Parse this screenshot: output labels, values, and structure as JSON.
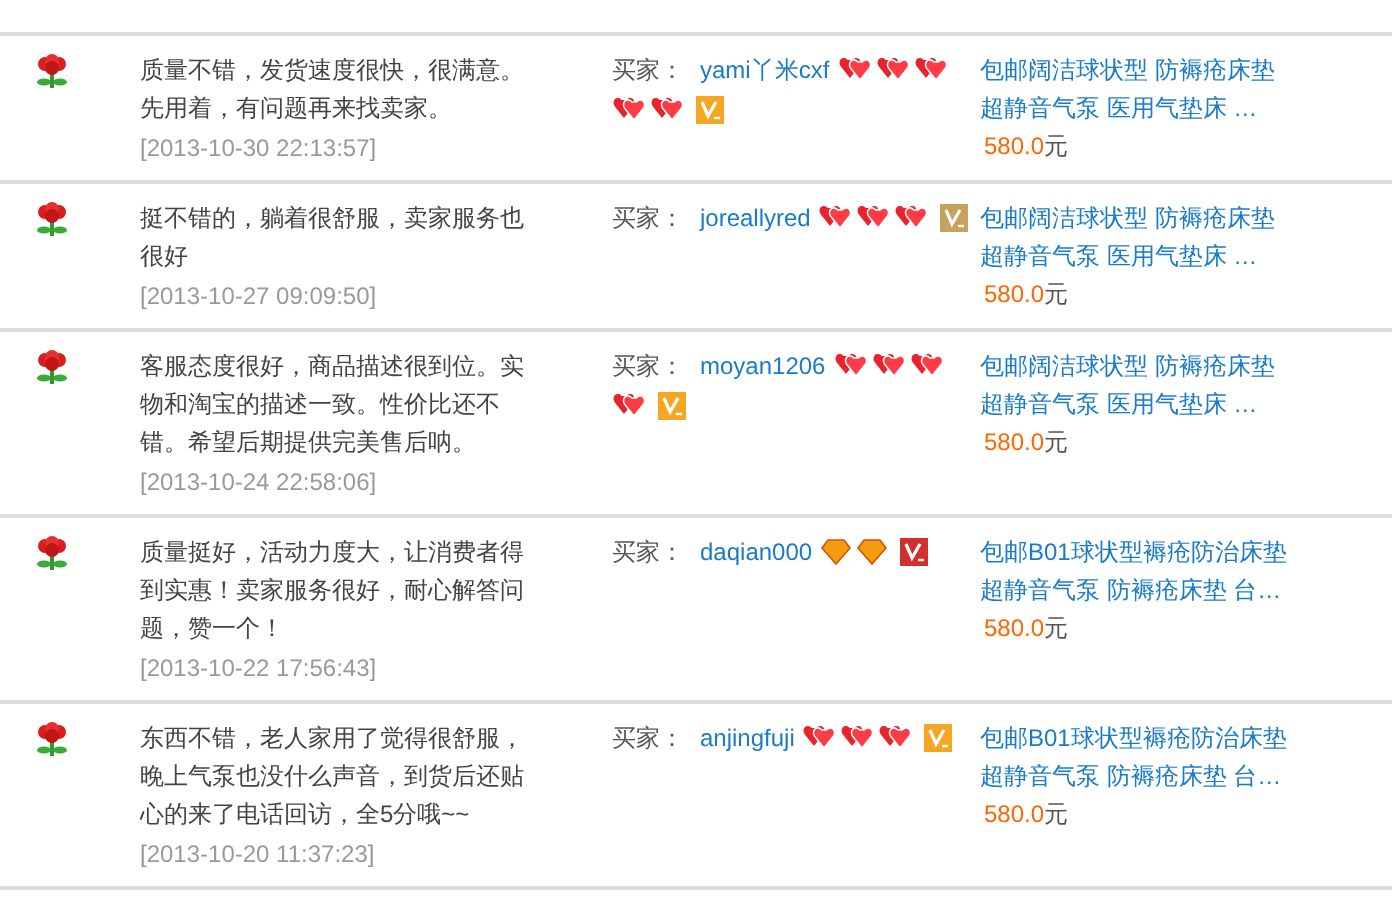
{
  "reviews": [
    {
      "comment": "质量不错，发货速度很快，很满意。先用着，有问题再来找卖家。",
      "time": "[2013-10-30 22:13:57]",
      "buyer_label": "买家：",
      "buyer": "yami丫米cxf",
      "badges": [
        {
          "kind": "heart"
        },
        {
          "kind": "heart"
        },
        {
          "kind": "heart"
        },
        {
          "kind": "heart"
        },
        {
          "kind": "heart"
        }
      ],
      "vip": {
        "color": "#f5a623"
      },
      "product_lines": [
        "包邮阔洁球状型 防褥疮床垫",
        "超静音气泵 医用气垫床 …"
      ],
      "price": "580.0",
      "currency": "元"
    },
    {
      "comment": "挺不错的，躺着很舒服，卖家服务也很好",
      "time": "[2013-10-27 09:09:50]",
      "buyer_label": "买家：",
      "buyer": "joreallyred",
      "badges": [
        {
          "kind": "heart"
        },
        {
          "kind": "heart"
        },
        {
          "kind": "heart"
        }
      ],
      "vip": {
        "color": "#c8a060"
      },
      "product_lines": [
        "包邮阔洁球状型 防褥疮床垫",
        "超静音气泵 医用气垫床 …"
      ],
      "price": "580.0",
      "currency": "元"
    },
    {
      "comment": "客服态度很好，商品描述很到位。实物和淘宝的描述一致。性价比还不错。希望后期提供完美售后呐。",
      "time": "[2013-10-24 22:58:06]",
      "buyer_label": "买家：",
      "buyer": "moyan1206",
      "badges": [
        {
          "kind": "heart"
        },
        {
          "kind": "heart"
        },
        {
          "kind": "heart"
        },
        {
          "kind": "heart"
        }
      ],
      "vip": {
        "color": "#f5a623"
      },
      "product_lines": [
        "包邮阔洁球状型 防褥疮床垫",
        "超静音气泵 医用气垫床 …"
      ],
      "price": "580.0",
      "currency": "元"
    },
    {
      "comment": "质量挺好，活动力度大，让消费者得到实惠！卖家服务很好，耐心解答问题，赞一个！",
      "time": "[2013-10-22 17:56:43]",
      "buyer_label": "买家：",
      "buyer": "daqian000",
      "badges": [
        {
          "kind": "diamond"
        },
        {
          "kind": "diamond"
        }
      ],
      "vip": {
        "color": "#d0312d"
      },
      "product_lines": [
        "包邮B01球状型褥疮防治床垫",
        "超静音气泵 防褥疮床垫 台…"
      ],
      "price": "580.0",
      "currency": "元"
    },
    {
      "comment": "东西不错，老人家用了觉得很舒服，晚上气泵也没什么声音，到货后还贴心的来了电话回访，全5分哦~~",
      "time": "[2013-10-20 11:37:23]",
      "buyer_label": "买家：",
      "buyer": "anjingfuji",
      "badges": [
        {
          "kind": "heart"
        },
        {
          "kind": "heart"
        },
        {
          "kind": "heart"
        }
      ],
      "vip": {
        "color": "#f5a623"
      },
      "product_lines": [
        "包邮B01球状型褥疮防治床垫",
        "超静音气泵 防褥疮床垫 台…"
      ],
      "price": "580.0",
      "currency": "元"
    }
  ]
}
